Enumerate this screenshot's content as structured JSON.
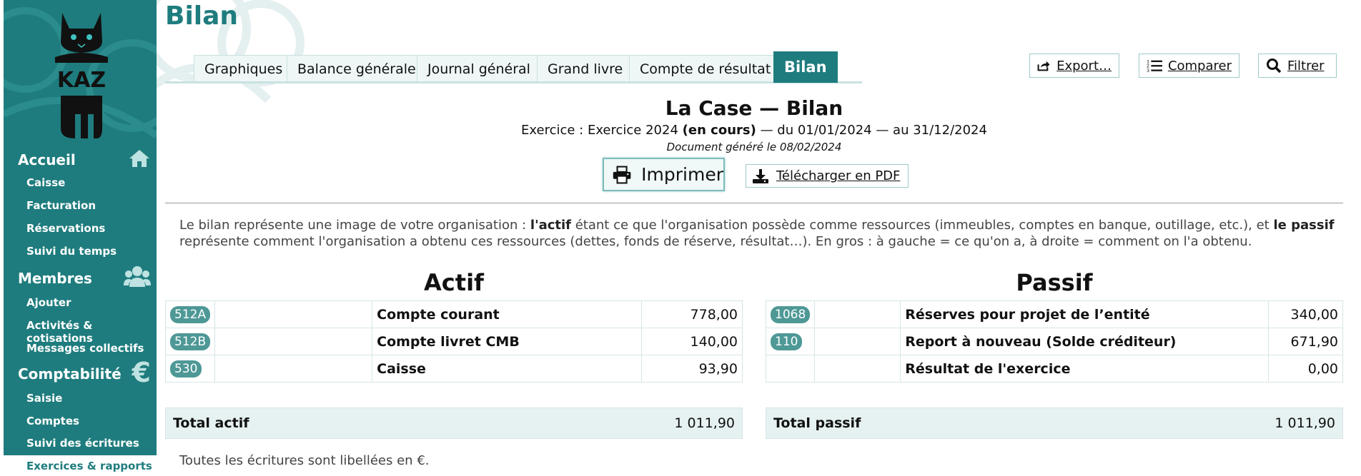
{
  "page_title": "Bilan",
  "sidebar": {
    "logo_text": "KAZ",
    "sections": [
      {
        "label": "Accueil",
        "icon": "home-icon",
        "items": [
          "Caisse",
          "Facturation",
          "Réservations",
          "Suivi du temps"
        ]
      },
      {
        "label": "Membres",
        "icon": "users-icon",
        "items": [
          "Ajouter",
          "Activités & cotisations",
          "Messages collectifs"
        ]
      },
      {
        "label": "Comptabilité",
        "icon": "euro-icon",
        "items": [
          "Saisie",
          "Comptes",
          "Suivi des écritures",
          "Exercices & rapports"
        ]
      }
    ],
    "current_item": "Exercices & rapports"
  },
  "tabs": [
    "Graphiques",
    "Balance générale",
    "Journal général",
    "Grand livre",
    "Compte de résultat",
    "Bilan"
  ],
  "active_tab": "Bilan",
  "actions": {
    "export": "Export…",
    "compare": "Comparer",
    "filter": "Filtrer"
  },
  "report": {
    "title": "La Case — Bilan",
    "exercise_prefix": "Exercice : Exercice 2024",
    "exercise_status": "(en cours)",
    "exercise_suffix": "— du 01/01/2024 — au 31/12/2024",
    "generated": "Document généré le 08/02/2024",
    "print_label": "Imprimer",
    "pdf_label": "Télécharger en PDF"
  },
  "intro": {
    "p1": "Le bilan représente une image de votre organisation : ",
    "b1": "l'actif",
    "p2": " étant ce que l'organisation possède comme ressources (immeubles, comptes en banque, outillage, etc.), et ",
    "b2": "le passif",
    "p3": " représente comment l'organisation a obtenu ces ressources (dettes, fonds de réserve, résultat…). En gros : à gauche = ce qu'on a, à droite = comment on l'a obtenu."
  },
  "actif": {
    "title": "Actif",
    "rows": [
      {
        "code": "512A",
        "label": "Compte courant",
        "amount": "778,00"
      },
      {
        "code": "512B",
        "label": "Compte livret CMB",
        "amount": "140,00"
      },
      {
        "code": "530",
        "label": "Caisse",
        "amount": "93,90"
      }
    ],
    "total_label": "Total actif",
    "total": "1 011,90"
  },
  "passif": {
    "title": "Passif",
    "rows": [
      {
        "code": "1068",
        "label": "Réserves pour projet de l’entité",
        "amount": "340,00"
      },
      {
        "code": "110",
        "label": "Report à nouveau (Solde créditeur)",
        "amount": "671,90"
      },
      {
        "code": "",
        "label": "Résultat de l'exercice",
        "amount": "0,00"
      }
    ],
    "total_label": "Total passif",
    "total": "1 011,90"
  },
  "footnote": "Toutes les écritures sont libellées en €."
}
